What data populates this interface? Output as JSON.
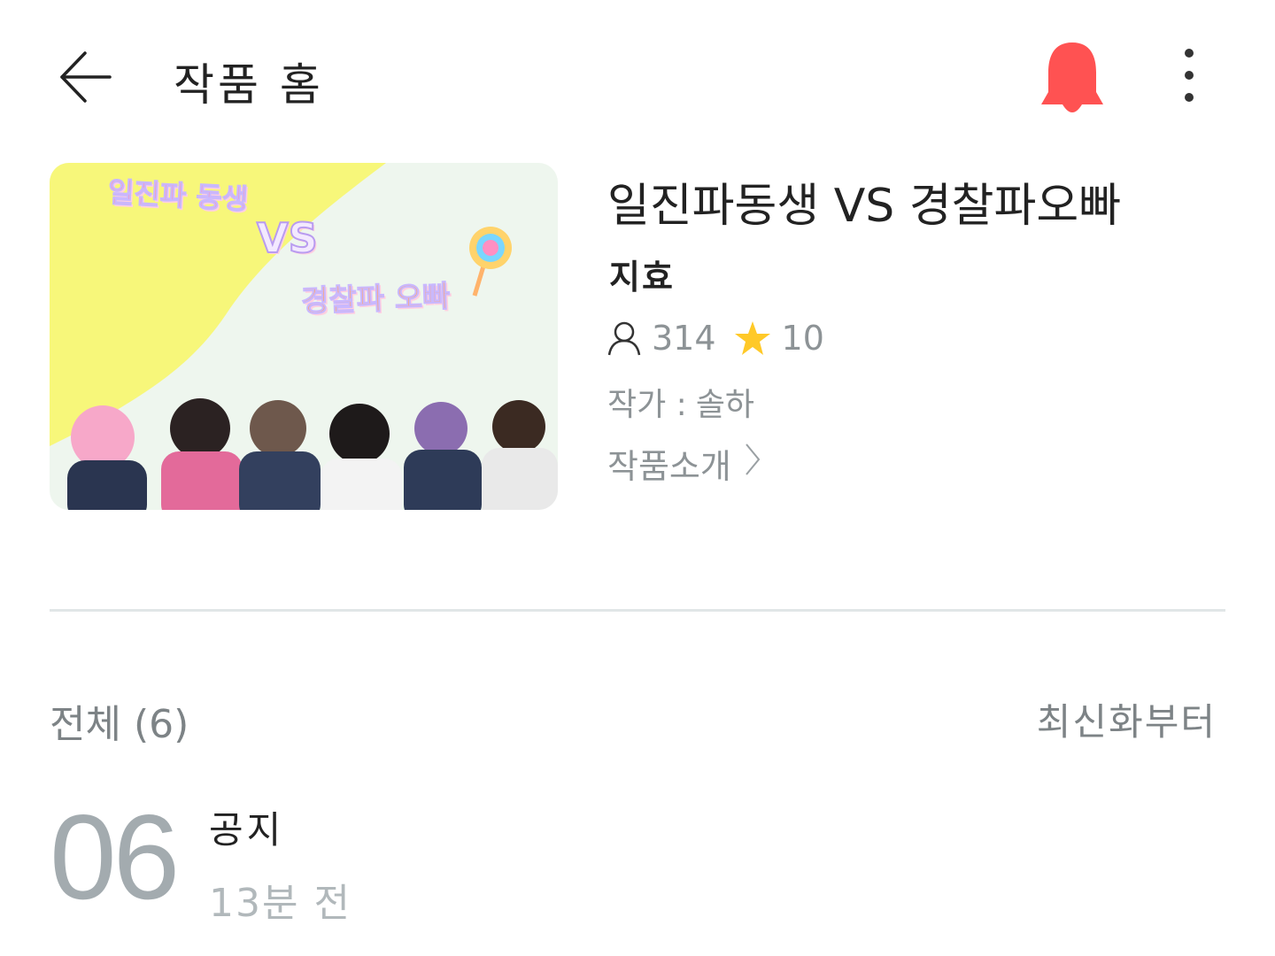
{
  "header": {
    "back_icon": "back-arrow-icon",
    "title": "작품 홈",
    "bell_icon": "bell-icon",
    "bell_color": "#ff5252",
    "more_icon": "more-vertical-icon"
  },
  "work": {
    "cover": {
      "line1": "일진파 동생",
      "line2": "VS",
      "line3": "경찰파 오빠"
    },
    "title": "일진파동생 VS 경찰파오빠",
    "genre": "지효",
    "views_icon": "person-icon",
    "views": "314",
    "rating_icon": "star-icon",
    "rating": "10",
    "author_label": "작가 :",
    "author_name": "솔하",
    "intro_label": "작품소개",
    "intro_icon": "chevron-right-icon"
  },
  "list": {
    "total": "전체 (6)",
    "sort": "최신화부터"
  },
  "episodes": [
    {
      "number": "06",
      "title": "공지",
      "time": "13분 전"
    }
  ],
  "colors": {
    "accent_red": "#ff5252",
    "star_yellow": "#ffc928",
    "muted_gray": "#8d9396"
  }
}
